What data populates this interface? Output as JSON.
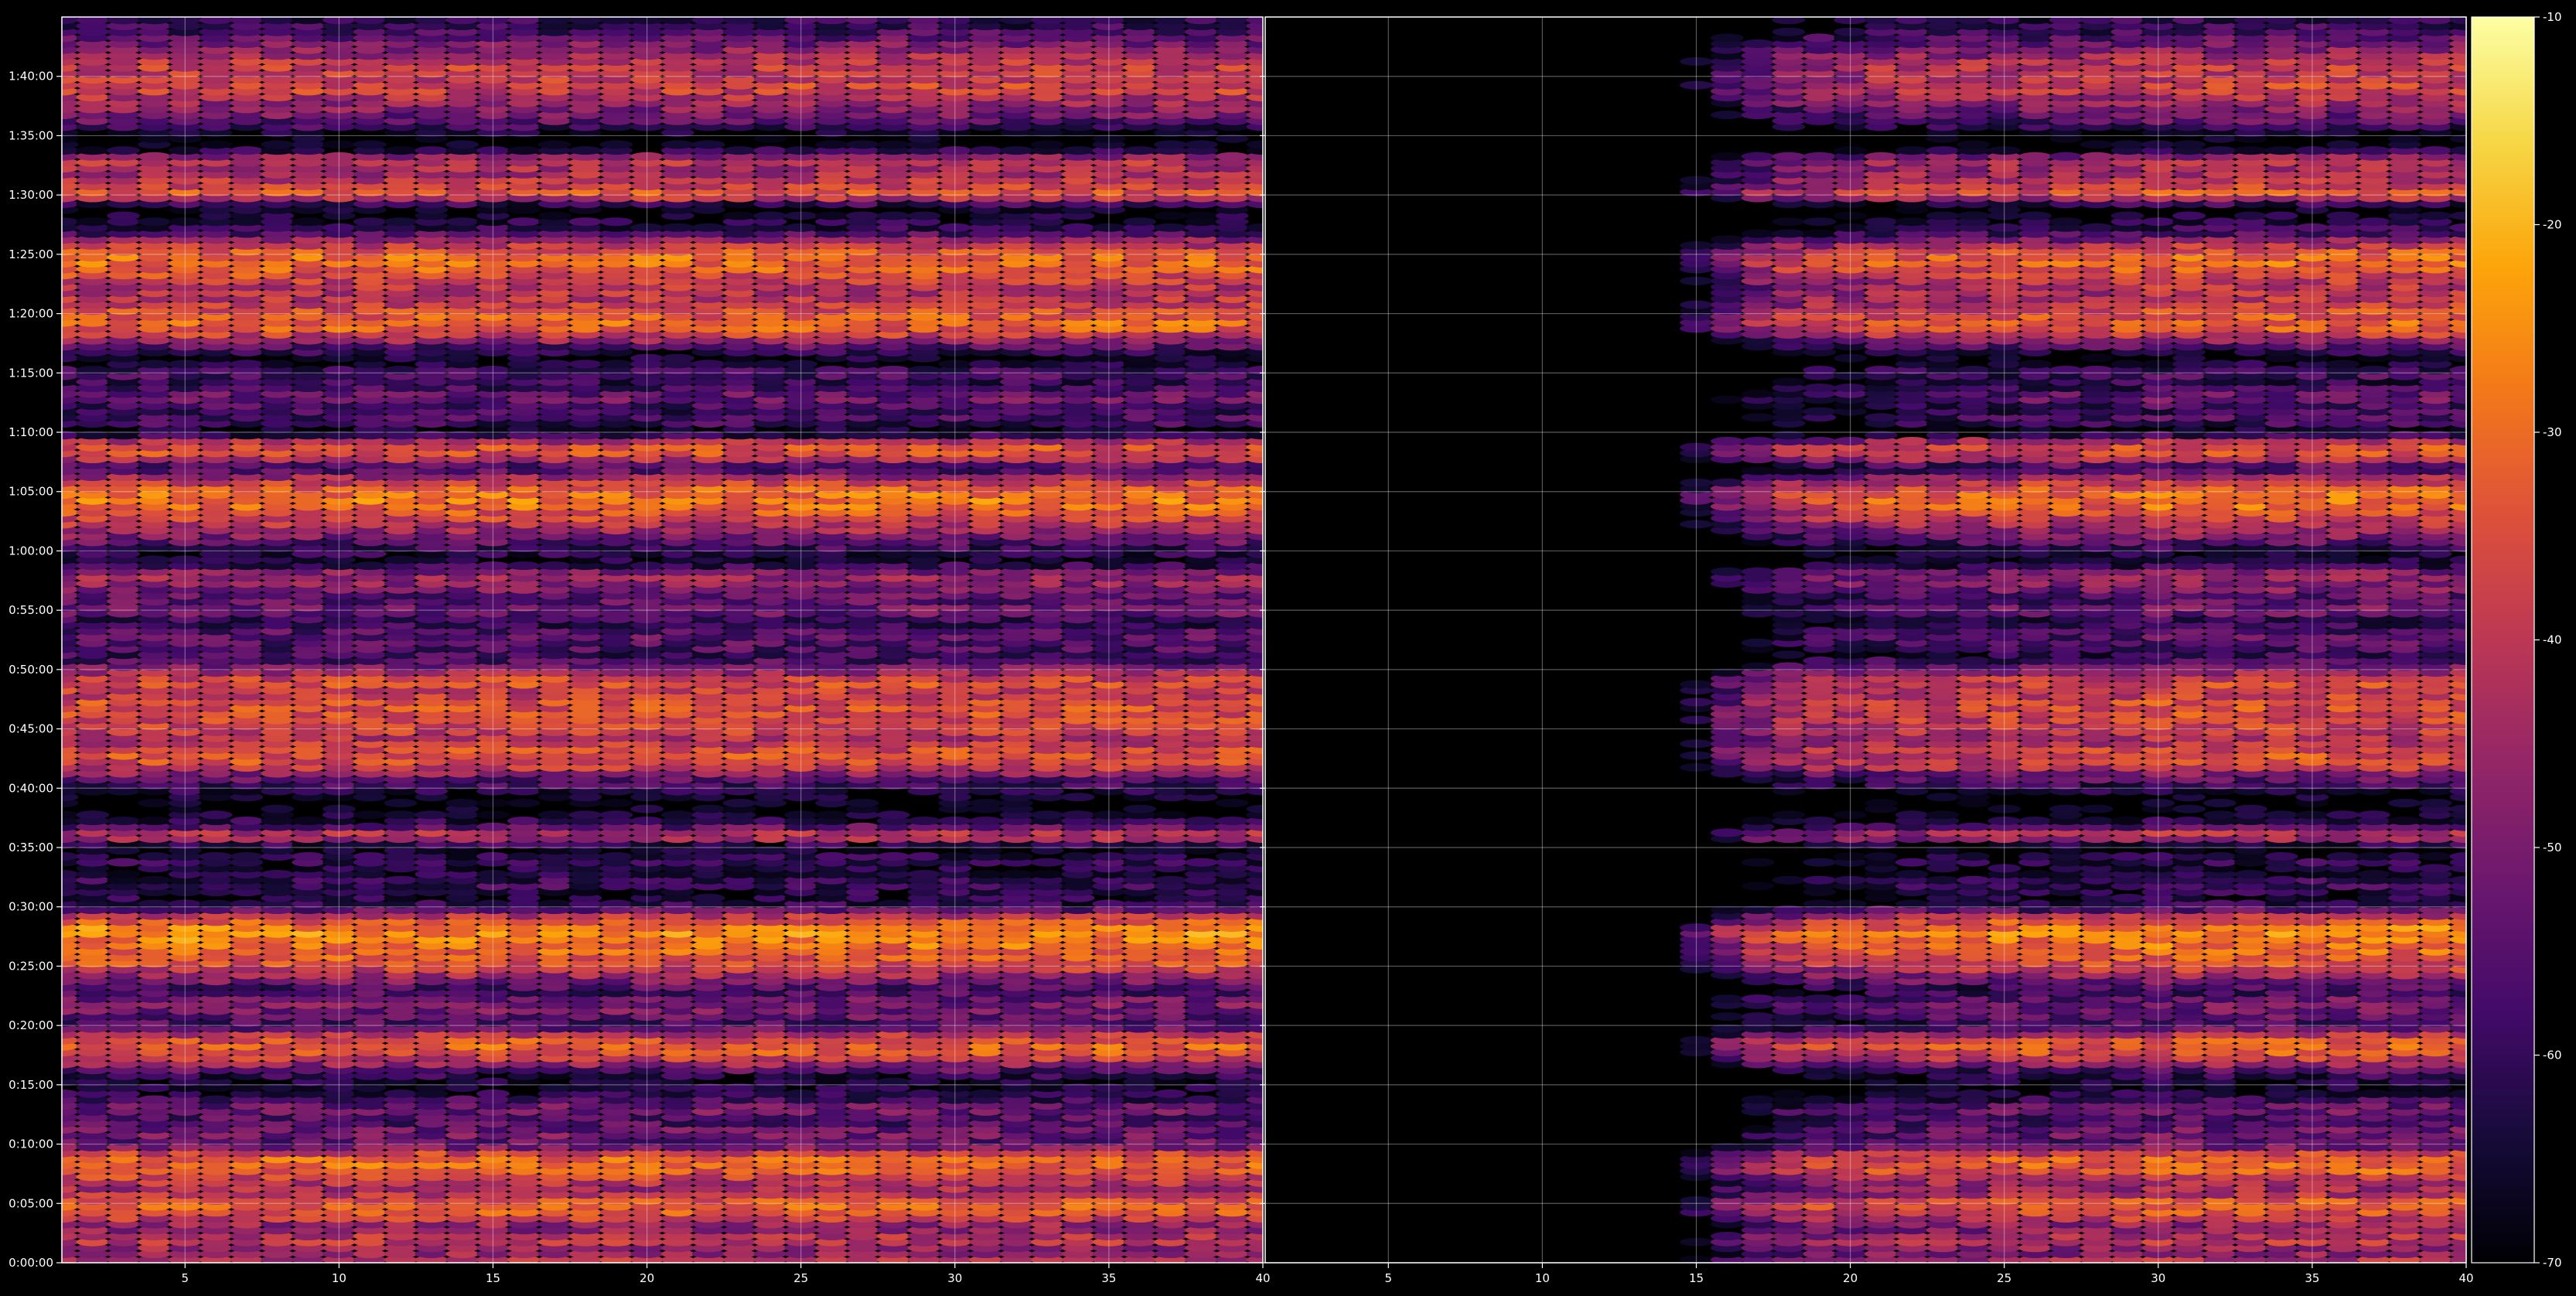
{
  "chart_data": [
    {
      "type": "heatmap",
      "title": "",
      "xlabel": "",
      "ylabel": "",
      "x_ticks": [
        5,
        10,
        15,
        20,
        25,
        30,
        35,
        40
      ],
      "x_tick_labels": [
        "5",
        "10",
        "15",
        "20",
        "25",
        "30",
        "35",
        "40"
      ],
      "xlim": [
        1,
        40
      ],
      "y_ticks_seconds": [
        0,
        300,
        600,
        900,
        1200,
        1500,
        1800,
        2100,
        2400,
        2700,
        3000,
        3300,
        3600,
        3900,
        4200,
        4500,
        4800,
        5100,
        5400,
        5700,
        6000
      ],
      "y_tick_labels": [
        "0:00:00",
        "0:05:00",
        "0:10:00",
        "0:15:00",
        "0:20:00",
        "0:25:00",
        "0:30:00",
        "0:35:00",
        "0:40:00",
        "0:45:00",
        "0:50:00",
        "0:55:00",
        "1:00:00",
        "1:05:00",
        "1:10:00",
        "1:15:00",
        "1:20:00",
        "1:25:00",
        "1:30:00",
        "1:35:00",
        "1:40:00"
      ],
      "ylim_seconds": [
        0,
        6300
      ],
      "grid": true,
      "value_range": [
        -70,
        -10
      ],
      "row_profile_dB": [
        [
          0,
          -40
        ],
        [
          60,
          -48
        ],
        [
          120,
          -38
        ],
        [
          180,
          -50
        ],
        [
          240,
          -35
        ],
        [
          300,
          -30
        ],
        [
          360,
          -45
        ],
        [
          420,
          -40
        ],
        [
          480,
          -30
        ],
        [
          540,
          -32
        ],
        [
          600,
          -55
        ],
        [
          660,
          -50
        ],
        [
          720,
          -58
        ],
        [
          780,
          -50
        ],
        [
          840,
          -62
        ],
        [
          900,
          -66
        ],
        [
          960,
          -60
        ],
        [
          1020,
          -42
        ],
        [
          1080,
          -30
        ],
        [
          1140,
          -36
        ],
        [
          1200,
          -58
        ],
        [
          1260,
          -52
        ],
        [
          1320,
          -50
        ],
        [
          1380,
          -60
        ],
        [
          1440,
          -48
        ],
        [
          1500,
          -36
        ],
        [
          1560,
          -32
        ],
        [
          1620,
          -28
        ],
        [
          1680,
          -25
        ],
        [
          1740,
          -35
        ],
        [
          1800,
          -60
        ],
        [
          1860,
          -64
        ],
        [
          1920,
          -58
        ],
        [
          1980,
          -66
        ],
        [
          2040,
          -60
        ],
        [
          2100,
          -70
        ],
        [
          2160,
          -36
        ],
        [
          2220,
          -60
        ],
        [
          2280,
          -68
        ],
        [
          2340,
          -70
        ],
        [
          2400,
          -60
        ],
        [
          2460,
          -52
        ],
        [
          2520,
          -36
        ],
        [
          2580,
          -34
        ],
        [
          2640,
          -42
        ],
        [
          2700,
          -38
        ],
        [
          2760,
          -36
        ],
        [
          2820,
          -34
        ],
        [
          2880,
          -40
        ],
        [
          2940,
          -34
        ],
        [
          3000,
          -48
        ],
        [
          3060,
          -60
        ],
        [
          3120,
          -56
        ],
        [
          3180,
          -54
        ],
        [
          3240,
          -62
        ],
        [
          3300,
          -50
        ],
        [
          3360,
          -56
        ],
        [
          3420,
          -48
        ],
        [
          3480,
          -44
        ],
        [
          3540,
          -66
        ],
        [
          3600,
          -62
        ],
        [
          3660,
          -52
        ],
        [
          3720,
          -42
        ],
        [
          3780,
          -36
        ],
        [
          3840,
          -28
        ],
        [
          3900,
          -30
        ],
        [
          3960,
          -40
        ],
        [
          4020,
          -60
        ],
        [
          4080,
          -36
        ],
        [
          4140,
          -34
        ],
        [
          4200,
          -70
        ],
        [
          4260,
          -56
        ],
        [
          4320,
          -60
        ],
        [
          4380,
          -50
        ],
        [
          4440,
          -62
        ],
        [
          4500,
          -56
        ],
        [
          4560,
          -68
        ],
        [
          4620,
          -60
        ],
        [
          4680,
          -42
        ],
        [
          4740,
          -30
        ],
        [
          4800,
          -34
        ],
        [
          4860,
          -40
        ],
        [
          4920,
          -42
        ],
        [
          4980,
          -38
        ],
        [
          5040,
          -30
        ],
        [
          5100,
          -30
        ],
        [
          5160,
          -44
        ],
        [
          5220,
          -60
        ],
        [
          5280,
          -64
        ],
        [
          5340,
          -70
        ],
        [
          5400,
          -32
        ],
        [
          5460,
          -40
        ],
        [
          5520,
          -44
        ],
        [
          5580,
          -40
        ],
        [
          5640,
          -70
        ],
        [
          5700,
          -70
        ],
        [
          5760,
          -56
        ],
        [
          5820,
          -50
        ],
        [
          5880,
          -44
        ],
        [
          5940,
          -36
        ],
        [
          6000,
          -40
        ],
        [
          6060,
          -38
        ],
        [
          6120,
          -46
        ],
        [
          6180,
          -52
        ],
        [
          6240,
          -60
        ]
      ],
      "column_level_dB": [
        0,
        0,
        0,
        0,
        0,
        0,
        0,
        0,
        0,
        0,
        0,
        0,
        0,
        0,
        0,
        0,
        0,
        0,
        0,
        0,
        0,
        0,
        0,
        0,
        0,
        0,
        0,
        0,
        0,
        0,
        0,
        0,
        0,
        0,
        0,
        0,
        0,
        0,
        0,
        0
      ]
    },
    {
      "type": "heatmap",
      "title": "",
      "xlabel": "",
      "ylabel": "",
      "x_ticks": [
        5,
        10,
        15,
        20,
        25,
        30,
        35,
        40
      ],
      "x_tick_labels": [
        "5",
        "10",
        "15",
        "20",
        "25",
        "30",
        "35",
        "40"
      ],
      "xlim": [
        1,
        40
      ],
      "y_ticks_seconds": [
        0,
        300,
        600,
        900,
        1200,
        1500,
        1800,
        2100,
        2400,
        2700,
        3000,
        3300,
        3600,
        3900,
        4200,
        4500,
        4800,
        5100,
        5400,
        5700,
        6000
      ],
      "y_tick_labels": [],
      "ylim_seconds": [
        0,
        6300
      ],
      "grid": true,
      "value_range": [
        -70,
        -10
      ],
      "row_profile_dB": [
        [
          0,
          -40
        ],
        [
          60,
          -48
        ],
        [
          120,
          -38
        ],
        [
          180,
          -50
        ],
        [
          240,
          -35
        ],
        [
          300,
          -30
        ],
        [
          360,
          -45
        ],
        [
          420,
          -40
        ],
        [
          480,
          -30
        ],
        [
          540,
          -32
        ],
        [
          600,
          -55
        ],
        [
          660,
          -50
        ],
        [
          720,
          -58
        ],
        [
          780,
          -50
        ],
        [
          840,
          -62
        ],
        [
          900,
          -66
        ],
        [
          960,
          -60
        ],
        [
          1020,
          -42
        ],
        [
          1080,
          -30
        ],
        [
          1140,
          -36
        ],
        [
          1200,
          -58
        ],
        [
          1260,
          -52
        ],
        [
          1320,
          -50
        ],
        [
          1380,
          -60
        ],
        [
          1440,
          -48
        ],
        [
          1500,
          -36
        ],
        [
          1560,
          -32
        ],
        [
          1620,
          -28
        ],
        [
          1680,
          -25
        ],
        [
          1740,
          -35
        ],
        [
          1800,
          -60
        ],
        [
          1860,
          -64
        ],
        [
          1920,
          -58
        ],
        [
          1980,
          -66
        ],
        [
          2040,
          -60
        ],
        [
          2100,
          -70
        ],
        [
          2160,
          -36
        ],
        [
          2220,
          -60
        ],
        [
          2280,
          -68
        ],
        [
          2340,
          -70
        ],
        [
          2400,
          -60
        ],
        [
          2460,
          -52
        ],
        [
          2520,
          -36
        ],
        [
          2580,
          -34
        ],
        [
          2640,
          -42
        ],
        [
          2700,
          -38
        ],
        [
          2760,
          -36
        ],
        [
          2820,
          -34
        ],
        [
          2880,
          -40
        ],
        [
          2940,
          -34
        ],
        [
          3000,
          -48
        ],
        [
          3060,
          -60
        ],
        [
          3120,
          -56
        ],
        [
          3180,
          -54
        ],
        [
          3240,
          -62
        ],
        [
          3300,
          -50
        ],
        [
          3360,
          -56
        ],
        [
          3420,
          -48
        ],
        [
          3480,
          -44
        ],
        [
          3540,
          -66
        ],
        [
          3600,
          -62
        ],
        [
          3660,
          -52
        ],
        [
          3720,
          -42
        ],
        [
          3780,
          -36
        ],
        [
          3840,
          -28
        ],
        [
          3900,
          -30
        ],
        [
          3960,
          -40
        ],
        [
          4020,
          -60
        ],
        [
          4080,
          -36
        ],
        [
          4140,
          -34
        ],
        [
          4200,
          -70
        ],
        [
          4260,
          -56
        ],
        [
          4320,
          -60
        ],
        [
          4380,
          -50
        ],
        [
          4440,
          -62
        ],
        [
          4500,
          -56
        ],
        [
          4560,
          -68
        ],
        [
          4620,
          -60
        ],
        [
          4680,
          -42
        ],
        [
          4740,
          -30
        ],
        [
          4800,
          -34
        ],
        [
          4860,
          -40
        ],
        [
          4920,
          -42
        ],
        [
          4980,
          -38
        ],
        [
          5040,
          -30
        ],
        [
          5100,
          -30
        ],
        [
          5160,
          -44
        ],
        [
          5220,
          -60
        ],
        [
          5280,
          -64
        ],
        [
          5340,
          -70
        ],
        [
          5400,
          -32
        ],
        [
          5460,
          -40
        ],
        [
          5520,
          -44
        ],
        [
          5580,
          -40
        ],
        [
          5640,
          -70
        ],
        [
          5700,
          -70
        ],
        [
          5760,
          -56
        ],
        [
          5820,
          -50
        ],
        [
          5880,
          -44
        ],
        [
          5940,
          -36
        ],
        [
          6000,
          -40
        ],
        [
          6060,
          -38
        ],
        [
          6120,
          -46
        ],
        [
          6180,
          -52
        ],
        [
          6240,
          -60
        ]
      ],
      "column_level_dB": [
        -60,
        -60,
        -60,
        -60,
        -60,
        -60,
        -60,
        -60,
        -60,
        -60,
        -60,
        -60,
        -55,
        -48,
        -30,
        -18,
        -12,
        -8,
        -6,
        -6,
        -4,
        -3,
        -3,
        -3,
        -2,
        -2,
        -2,
        -2,
        -1,
        0,
        0,
        0,
        0,
        0,
        0,
        0,
        0,
        0,
        0,
        0
      ]
    }
  ],
  "colorbar": {
    "ticks": [
      -10,
      -20,
      -30,
      -40,
      -50,
      -60,
      -70
    ],
    "tick_labels": [
      "-10",
      "-20",
      "-30",
      "-40",
      "-50",
      "-60",
      "-70"
    ],
    "range": [
      -70,
      -10
    ],
    "colormap": "inferno"
  },
  "colors": {
    "background": "#000000",
    "axis": "#ffffff",
    "grid": "#ffffff",
    "text": "#ffffff"
  }
}
